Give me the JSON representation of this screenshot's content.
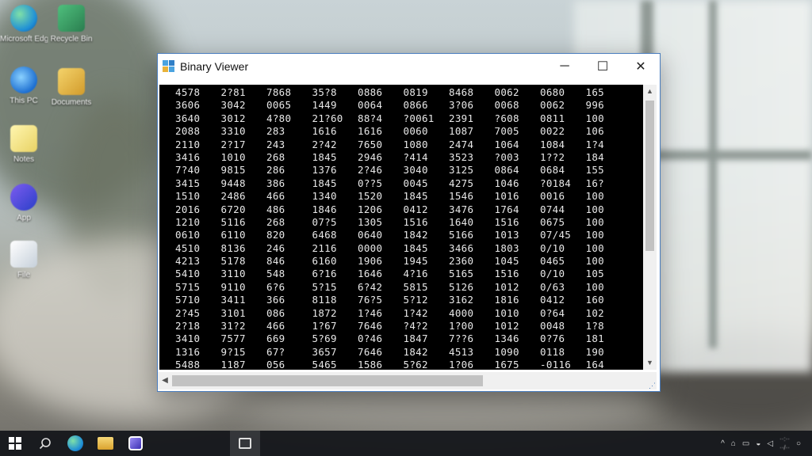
{
  "window": {
    "title": "Binary Viewer",
    "minimize_glyph": "─",
    "maximize_glyph": "☐",
    "close_glyph": "✕"
  },
  "grid": {
    "rows": [
      [
        "4578",
        "2?81",
        "7868",
        "35?8",
        "0886",
        "0819",
        "8468",
        "0062",
        "0680",
        "165"
      ],
      [
        "3606",
        "3042",
        "0065",
        "1449",
        "0064",
        "0866",
        "3?06",
        "0068",
        "0062",
        "996"
      ],
      [
        "3640",
        "3012",
        "4?80",
        "21?60",
        "88?4",
        "?0061",
        "2391",
        "?608",
        "0811",
        "100"
      ],
      [
        "2088",
        "3310",
        "283",
        "1616",
        "1616",
        "0060",
        "1087",
        "7005",
        "0022",
        "106"
      ],
      [
        "2110",
        "2?17",
        "243",
        "2?42",
        "7650",
        "1080",
        "2474",
        "1064",
        "1084",
        "1?4"
      ],
      [
        "3416",
        "1010",
        "268",
        "1845",
        "2946",
        "?414",
        "3523",
        "?003",
        "1??2",
        "184"
      ],
      [
        "7?40",
        "9815",
        "286",
        "1376",
        "2?46",
        "3040",
        "3125",
        "0864",
        "0684",
        "155"
      ],
      [
        "3415",
        "9448",
        "386",
        "1845",
        "0??5",
        "0045",
        "4275",
        "1046",
        "?0184",
        "16?"
      ],
      [
        "1510",
        "2486",
        "466",
        "1340",
        "1520",
        "1845",
        "1546",
        "1016",
        "0016",
        "100"
      ],
      [
        "2016",
        "6720",
        "486",
        "1846",
        "1206",
        "0412",
        "3476",
        "1764",
        "0744",
        "100"
      ],
      [
        "1210",
        "5116",
        "268",
        "07?5",
        "1305",
        "1516",
        "1640",
        "1516",
        "0675",
        "100"
      ],
      [
        "0610",
        "6110",
        "820",
        "6468",
        "0640",
        "1842",
        "5166",
        "1013",
        "07/45",
        "100"
      ],
      [
        "4510",
        "8136",
        "246",
        "2116",
        "0000",
        "1845",
        "3466",
        "1803",
        "0/10",
        "100"
      ],
      [
        "4213",
        "5178",
        "846",
        "6160",
        "1906",
        "1945",
        "2360",
        "1045",
        "0465",
        "100"
      ],
      [
        "5410",
        "3110",
        "548",
        "6?16",
        "1646",
        "4?16",
        "5165",
        "1516",
        "0/10",
        "105"
      ],
      [
        "5715",
        "9110",
        "6?6",
        "5?15",
        "6?42",
        "5815",
        "5126",
        "1012",
        "0/63",
        "100"
      ],
      [
        "5710",
        "3411",
        "366",
        "8118",
        "76?5",
        "5?12",
        "3162",
        "1816",
        "0412",
        "160"
      ],
      [
        "2?45",
        "3101",
        "086",
        "1872",
        "1?46",
        "1?42",
        "4000",
        "1010",
        "0?64",
        "102"
      ],
      [
        "2?18",
        "31?2",
        "466",
        "1?67",
        "7646",
        "?4?2",
        "1?00",
        "1012",
        "0048",
        "1?8"
      ],
      [
        "3410",
        "7577",
        "669",
        "5?69",
        "0?46",
        "1847",
        "7??6",
        "1346",
        "0?76",
        "181"
      ],
      [
        "1316",
        "9?15",
        "67?",
        "3657",
        "7646",
        "1842",
        "4513",
        "1090",
        "0118",
        "190"
      ],
      [
        "5488",
        "1187",
        "056",
        "5465",
        "1586",
        "5?62",
        "1?06",
        "1675",
        "-0116",
        "164"
      ]
    ]
  },
  "desktop_icons": [
    {
      "label": "Microsoft Edge",
      "color": "#2aa0d8"
    },
    {
      "label": "Recycle Bin",
      "color": "#3fa56a"
    },
    {
      "label": "This PC",
      "color": "#1d7fd1"
    },
    {
      "label": "Documents",
      "color": "#e6b640"
    },
    {
      "label": "Notes",
      "color": "#f2e27a"
    },
    {
      "label": "App",
      "color": "#3b4bd8"
    },
    {
      "label": "File",
      "color": "#dfe6ee"
    }
  ],
  "colors": {
    "accent": "#4a7dbe",
    "grid_bg": "#000000",
    "grid_text": "#e8e8e8",
    "taskbar": "#16181c"
  }
}
